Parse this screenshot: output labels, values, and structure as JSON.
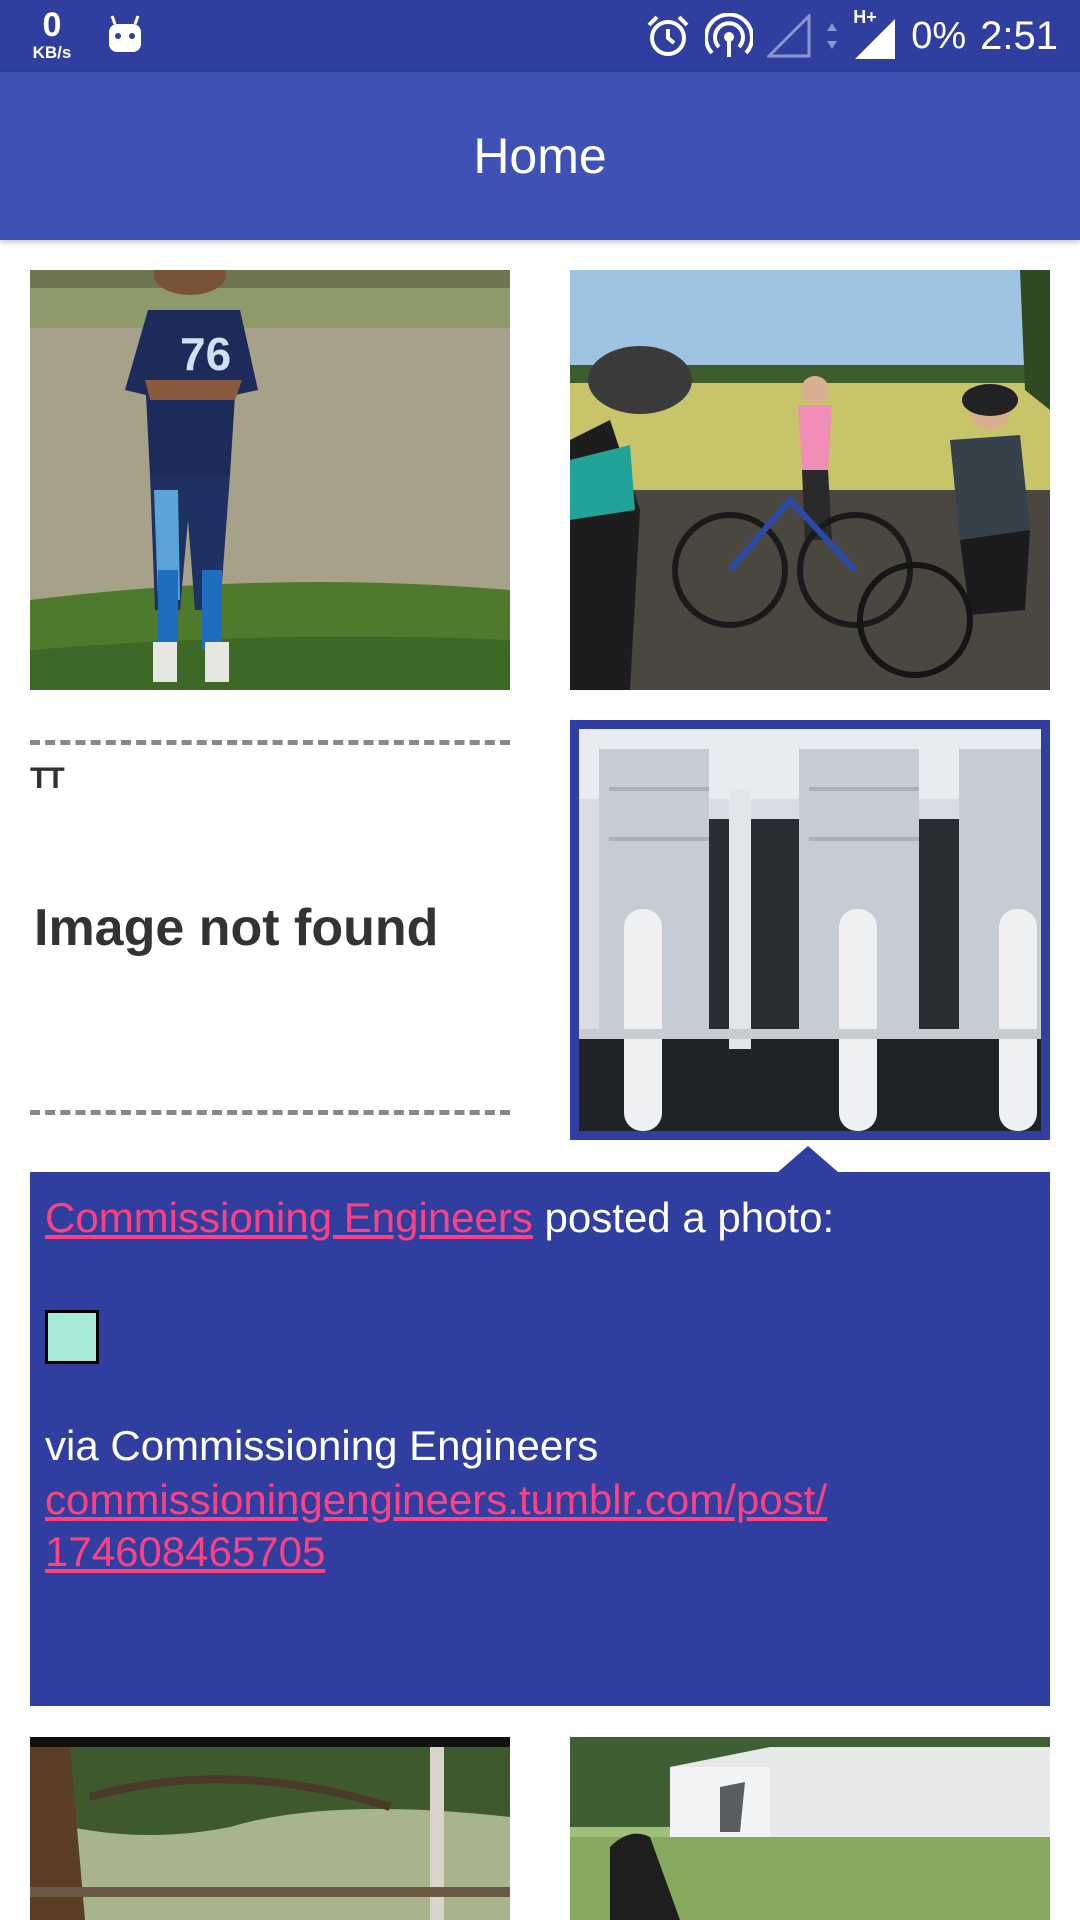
{
  "status_bar": {
    "net_speed_value": "0",
    "net_speed_unit": "KB/s",
    "battery": "0%",
    "time": "2:51",
    "icons": [
      "android-notification-icon",
      "alarm-icon",
      "hotspot-icon",
      "signal-empty-icon",
      "data-arrows-icon",
      "signal-hplus-icon"
    ],
    "network_label": "H+"
  },
  "app_bar": {
    "title": "Home",
    "color": "#3f51b5"
  },
  "grid": {
    "tiles": [
      {
        "name": "football-player-photo"
      },
      {
        "name": "cyclists-photo"
      },
      {
        "name": "image-not-found-placeholder",
        "tt_text": "TT",
        "text": "Image not found"
      },
      {
        "name": "industrial-ducts-photo",
        "selected": true
      },
      {
        "name": "trees-photo"
      },
      {
        "name": "hangar-photo"
      }
    ]
  },
  "detail_panel": {
    "author_link": "Commissioning Engineers",
    "posted_text": " posted a photo:",
    "via_text": "via Commissioning Engineers",
    "post_link_line1": "commissioningengineers.tumblr.com/post/",
    "post_link_line2": "174608465705",
    "background_color": "#303f9f",
    "link_color": "#ff4081",
    "thumb_color": "#a7e8d8"
  }
}
